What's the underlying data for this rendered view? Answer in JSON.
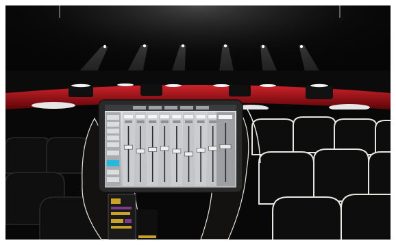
{
  "scene": {
    "subject": "tablet-mixing-console-in-theater",
    "colors": {
      "stage_red": "#b3121a",
      "tablet_body": "#2a2a2a",
      "screen_bg": "#cfd0d2",
      "seat_dark": "#0d0d0d",
      "seat_edge": "#e8e6e0"
    },
    "mixer": {
      "channel_count": 8,
      "fader_levels": [
        0.62,
        0.55,
        0.58,
        0.6,
        0.55,
        0.5,
        0.57,
        0.6
      ],
      "master_level": 0.6
    }
  }
}
